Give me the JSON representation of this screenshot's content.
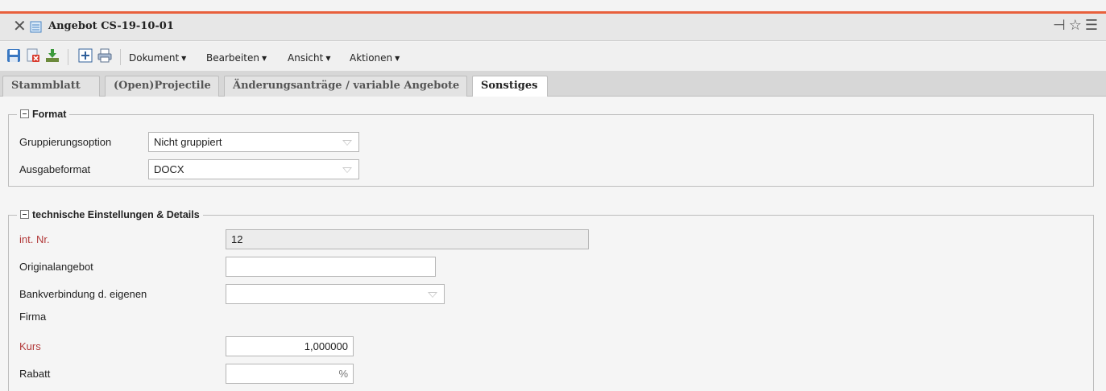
{
  "window": {
    "title": "Angebot CS-19-10-01"
  },
  "toolbar": {
    "menus": [
      "Dokument",
      "Bearbeiten",
      "Ansicht",
      "Aktionen"
    ]
  },
  "tabs": [
    {
      "label": "Stammblatt"
    },
    {
      "label": "(Open)Projectile"
    },
    {
      "label": "Änderungsanträge / variable Angebote"
    },
    {
      "label": "Sonstiges",
      "active": true
    }
  ],
  "format": {
    "legend": "Format",
    "grouping_label": "Gruppierungsoption",
    "grouping_value": "Nicht gruppiert",
    "output_label": "Ausgabeformat",
    "output_value": "DOCX"
  },
  "technical": {
    "legend": "technische Einstellungen & Details",
    "int_nr_label": "int. Nr.",
    "int_nr_value": "12",
    "original_label": "Originalangebot",
    "original_value": "",
    "bank_label_line1": "Bankverbindung d. eigenen",
    "bank_label_line2": "Firma",
    "bank_value": "",
    "kurs_label": "Kurs",
    "kurs_value": "1,000000",
    "rabatt_label": "Rabatt",
    "rabatt_value": "%"
  },
  "colors": {
    "accent": "#e8603c",
    "required_label": "#b23a3a"
  }
}
